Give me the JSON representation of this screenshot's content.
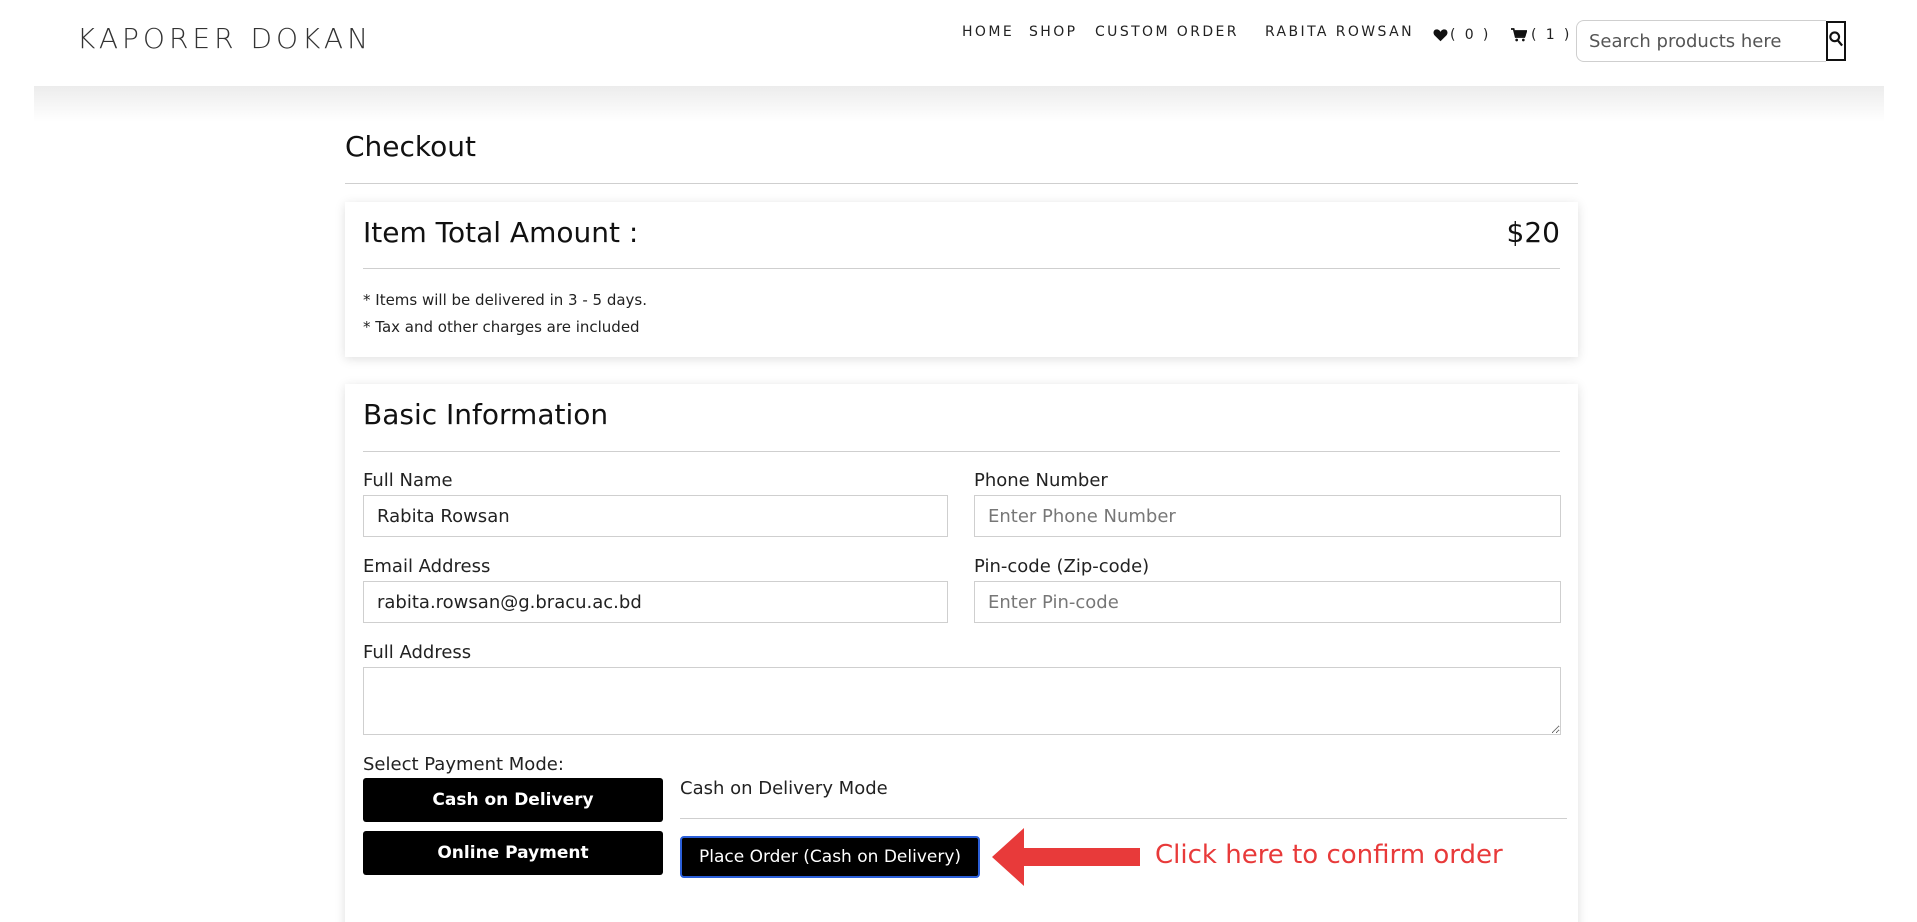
{
  "header": {
    "brand": "KAPORER DOKAN",
    "nav": {
      "home": "HOME",
      "shop": "SHOP",
      "custom_order": "CUSTOM ORDER",
      "user": "RABITA ROWSAN",
      "wishlist_count": "( 0 )",
      "cart_count": "( 1 )"
    },
    "search": {
      "placeholder": "Search products here"
    }
  },
  "checkout": {
    "title": "Checkout",
    "total": {
      "label": "Item Total Amount :",
      "value": "$20",
      "notes": [
        "* Items will be delivered in 3 - 5 days.",
        "* Tax and other charges are included"
      ]
    },
    "basic_info": {
      "title": "Basic Information",
      "full_name": {
        "label": "Full Name",
        "value": "Rabita Rowsan"
      },
      "phone": {
        "label": "Phone Number",
        "placeholder": "Enter Phone Number",
        "value": ""
      },
      "email": {
        "label": "Email Address",
        "value": "rabita.rowsan@g.bracu.ac.bd"
      },
      "pin": {
        "label": "Pin-code (Zip-code)",
        "placeholder": "Enter Pin-code",
        "value": ""
      },
      "address": {
        "label": "Full Address",
        "value": ""
      }
    },
    "payment": {
      "label": "Select Payment Mode:",
      "cod_button": "Cash on Delivery",
      "online_button": "Online Payment",
      "mode_title": "Cash on Delivery Mode",
      "place_order": "Place Order (Cash on Delivery)"
    }
  },
  "annotation": {
    "text": "Click here to confirm order",
    "color": "#e83a3a"
  },
  "icons": {
    "wishlist": "heart-icon",
    "cart": "cart-icon",
    "search": "search-icon"
  }
}
